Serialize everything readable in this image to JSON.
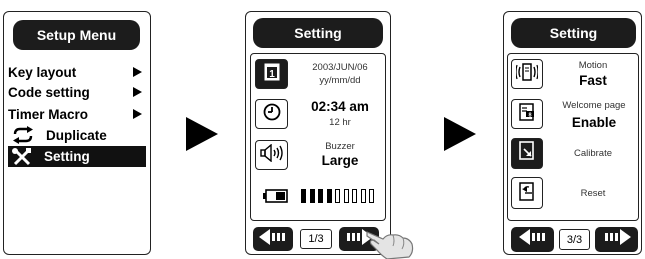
{
  "screen1": {
    "title": "Setup Menu",
    "items": [
      {
        "label": "Key layout",
        "has_submenu": true,
        "selected": false
      },
      {
        "label": "Code setting",
        "has_submenu": true,
        "selected": false
      },
      {
        "label": "Timer Macro",
        "has_submenu": true,
        "selected": false
      },
      {
        "label": "Duplicate",
        "has_submenu": false,
        "selected": false,
        "icon": "duplicate-arrows-icon"
      },
      {
        "label": "Setting",
        "has_submenu": false,
        "selected": true,
        "icon": "tools-icon"
      }
    ]
  },
  "screen2": {
    "title": "Setting",
    "date_value": "2003/JUN/06",
    "date_format": "yy/mm/dd",
    "time_value": "02:34 am",
    "time_format": "12 hr",
    "buzzer_label": "Buzzer",
    "buzzer_value": "Large",
    "battery_level_segments": 4,
    "battery_total_segments": 9,
    "page": "1/3"
  },
  "screen3": {
    "title": "Setting",
    "motion_label": "Motion",
    "motion_value": "Fast",
    "welcome_label": "Welcome page",
    "welcome_value": "Enable",
    "calibrate_label": "Calibrate",
    "reset_label": "Reset",
    "page": "3/3"
  },
  "colors": {
    "dark": "#1c1c1c",
    "border": "#222222",
    "background": "#ffffff"
  }
}
